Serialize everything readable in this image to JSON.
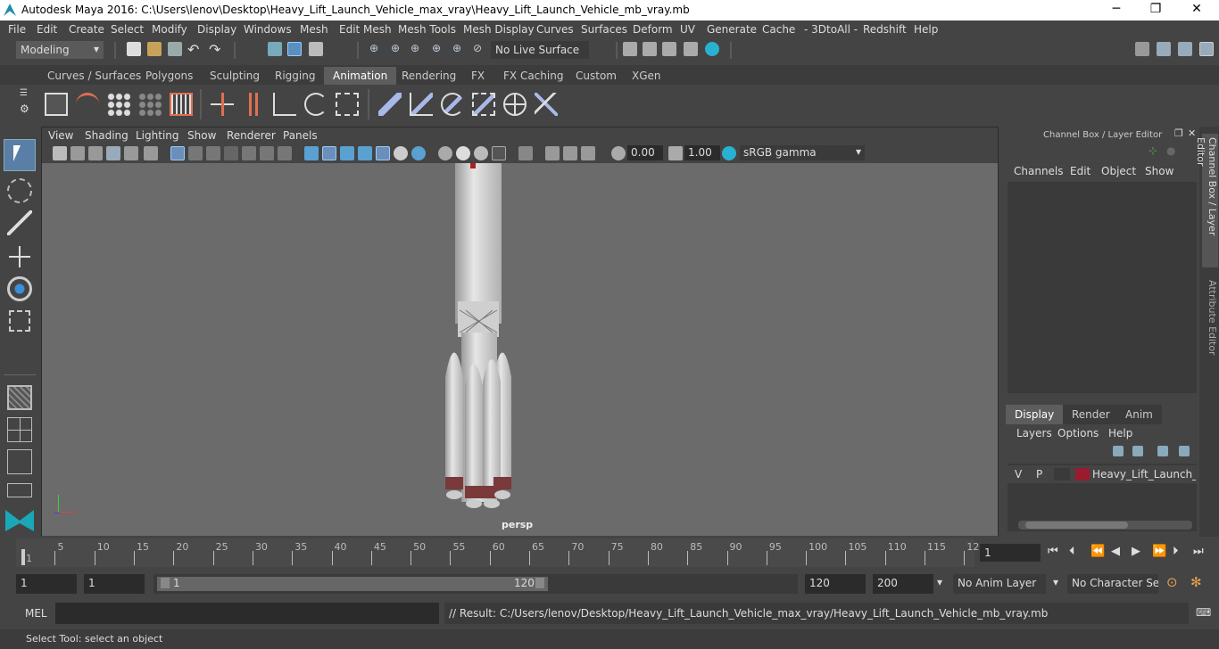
{
  "window": {
    "title": "Autodesk Maya 2016: C:\\Users\\lenov\\Desktop\\Heavy_Lift_Launch_Vehicle_max_vray\\Heavy_Lift_Launch_Vehicle_mb_vray.mb",
    "minimize": "─",
    "restore": "❐",
    "close": "✕"
  },
  "menu": [
    "File",
    "Edit",
    "Create",
    "Select",
    "Modify",
    "Display",
    "Windows",
    "Mesh",
    "Edit Mesh",
    "Mesh Tools",
    "Mesh Display",
    "Curves",
    "Surfaces",
    "Deform",
    "UV",
    "Generate",
    "Cache",
    "- 3DtoAll -",
    "Redshift",
    "Help"
  ],
  "status": {
    "mode": "Modeling",
    "live_surface": "No Live Surface"
  },
  "shelf_tabs": [
    "Curves / Surfaces",
    "Polygons",
    "Sculpting",
    "Rigging",
    "Animation",
    "Rendering",
    "FX",
    "FX Caching",
    "Custom",
    "XGen"
  ],
  "shelf_active": "Animation",
  "viewport": {
    "menu": [
      "View",
      "Shading",
      "Lighting",
      "Show",
      "Renderer",
      "Panels"
    ],
    "exposure": "0.00",
    "gamma": "1.00",
    "colorspace": "sRGB gamma",
    "camera_label": "persp"
  },
  "channelbox": {
    "title": "Channel Box / Layer Editor",
    "menu": [
      "Channels",
      "Edit",
      "Object",
      "Show"
    ],
    "layer_tabs": [
      "Display",
      "Render",
      "Anim"
    ],
    "layer_menu": [
      "Layers",
      "Options",
      "Help"
    ],
    "layer": {
      "v": "V",
      "p": "P",
      "name": "Heavy_Lift_Launch_Vehicle",
      "color": "#9b1b2e"
    }
  },
  "sidetabs": [
    "Channel Box / Layer Editor",
    "Attribute Editor"
  ],
  "timeline": {
    "ticks": [
      "1",
      "5",
      "10",
      "15",
      "20",
      "25",
      "30",
      "35",
      "40",
      "45",
      "50",
      "55",
      "60",
      "65",
      "70",
      "75",
      "80",
      "85",
      "90",
      "95",
      "100",
      "105",
      "110",
      "115",
      "12"
    ],
    "current_frame": "1"
  },
  "range": {
    "start": "1",
    "playback_start": "1",
    "slider_start": "1",
    "slider_end": "120",
    "playback_end": "120",
    "end": "200",
    "anim_layer": "No Anim Layer",
    "char_set": "No Character Set"
  },
  "cmd": {
    "lang": "MEL",
    "result": "// Result: C:/Users/lenov/Desktop/Heavy_Lift_Launch_Vehicle_max_vray/Heavy_Lift_Launch_Vehicle_mb_vray.mb"
  },
  "help_line": "Select Tool: select an object",
  "colors": {
    "accent": "#5d5d5d",
    "viewport_bg": "#6b6b6b",
    "layer_color": "#9b1b2e"
  }
}
